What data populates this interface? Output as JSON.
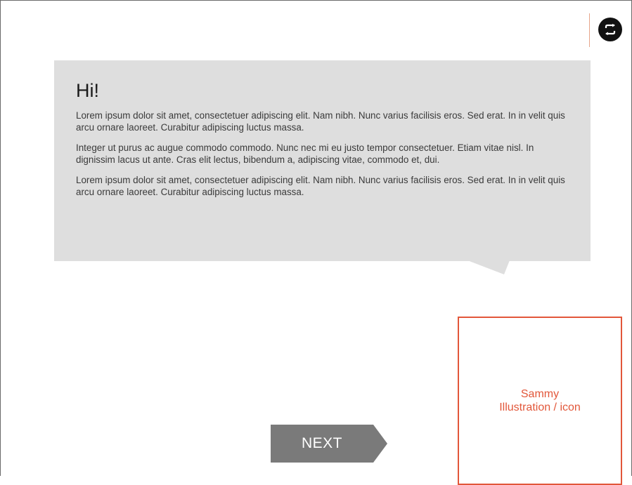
{
  "top_button": {
    "icon": "swap-arrows-icon"
  },
  "speech_bubble": {
    "heading": "Hi!",
    "paragraphs": [
      "Lorem ipsum dolor sit amet, consectetuer adipiscing elit. Nam nibh. Nunc varius facilisis eros. Sed erat. In in velit quis arcu ornare laoreet. Curabitur adipiscing luctus massa.",
      "Integer ut purus ac augue commodo commodo. Nunc nec mi eu justo tempor consectetuer. Etiam vitae nisl. In dignissim lacus ut ante. Cras elit lectus, bibendum a, adipiscing vitae, commodo et, dui.",
      "Lorem ipsum dolor sit amet, consectetuer adipiscing elit. Nam nibh. Nunc varius facilisis eros. Sed erat. In in velit quis arcu ornare laoreet. Curabitur adipiscing luctus massa."
    ]
  },
  "illustration_placeholder": {
    "line1": "Sammy",
    "line2": "Illustration / icon"
  },
  "next_button": {
    "label": "NEXT"
  },
  "colors": {
    "bubble_bg": "#dedede",
    "accent": "#e2573a",
    "button_bg": "#7a7a7a",
    "icon_bg": "#111111"
  }
}
